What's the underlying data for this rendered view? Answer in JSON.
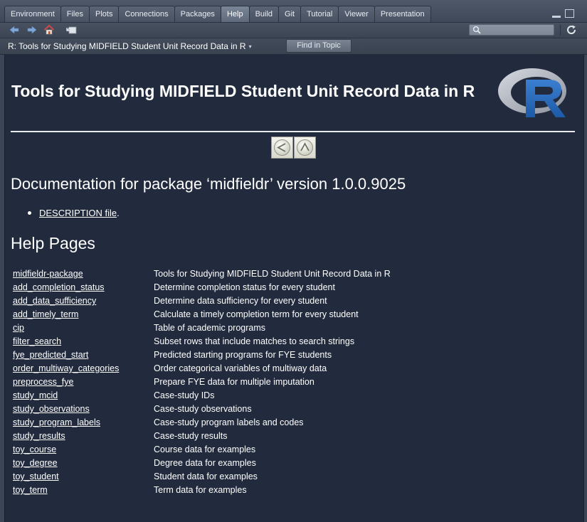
{
  "tabs": [
    {
      "label": "Environment"
    },
    {
      "label": "Files"
    },
    {
      "label": "Plots"
    },
    {
      "label": "Connections"
    },
    {
      "label": "Packages"
    },
    {
      "label": "Help",
      "active": true
    },
    {
      "label": "Build"
    },
    {
      "label": "Git"
    },
    {
      "label": "Tutorial"
    },
    {
      "label": "Viewer"
    },
    {
      "label": "Presentation"
    }
  ],
  "toolbar": {
    "icons": [
      "back-arrow-icon",
      "forward-arrow-icon",
      "home-icon",
      "popout-icon",
      "search-icon",
      "refresh-icon"
    ],
    "search_placeholder": ""
  },
  "topicbar": {
    "title": "R: Tools for Studying MIDFIELD Student Unit Record Data in R",
    "caret": "▾",
    "find_label": "Find in Topic"
  },
  "page": {
    "title": "Tools for Studying MIDFIELD Student Unit Record Data in R",
    "logo_letter": "R",
    "doc_heading": "Documentation for package ‘midfieldr’ version 1.0.0.9025",
    "description_link": "DESCRIPTION file",
    "description_suffix": ".",
    "help_heading": "Help Pages",
    "help_pages": [
      {
        "name": "midfieldr-package",
        "desc": "Tools for Studying MIDFIELD Student Unit Record Data in R"
      },
      {
        "name": "add_completion_status",
        "desc": "Determine completion status for every student"
      },
      {
        "name": "add_data_sufficiency",
        "desc": "Determine data sufficiency for every student"
      },
      {
        "name": "add_timely_term",
        "desc": "Calculate a timely completion term for every student"
      },
      {
        "name": "cip",
        "desc": "Table of academic programs"
      },
      {
        "name": "filter_search",
        "desc": "Subset rows that include matches to search strings"
      },
      {
        "name": "fye_predicted_start",
        "desc": "Predicted starting programs for FYE students"
      },
      {
        "name": "order_multiway_categories",
        "desc": "Order categorical variables of multiway data"
      },
      {
        "name": "preprocess_fye",
        "desc": "Prepare FYE data for multiple imputation"
      },
      {
        "name": "study_mcid",
        "desc": "Case-study IDs"
      },
      {
        "name": "study_observations",
        "desc": "Case-study observations"
      },
      {
        "name": "study_program_labels",
        "desc": "Case-study program labels and codes"
      },
      {
        "name": "study_results",
        "desc": "Case-study results"
      },
      {
        "name": "toy_course",
        "desc": "Course data for examples"
      },
      {
        "name": "toy_degree",
        "desc": "Degree data for examples"
      },
      {
        "name": "toy_student",
        "desc": "Student data for examples"
      },
      {
        "name": "toy_term",
        "desc": "Term data for examples"
      }
    ]
  },
  "colors": {
    "chrome": "#3b4556",
    "content_bg": "#222b3d",
    "text": "#ffffff",
    "logo_blue": "#2464b8",
    "logo_ring": "#a8adb8"
  }
}
